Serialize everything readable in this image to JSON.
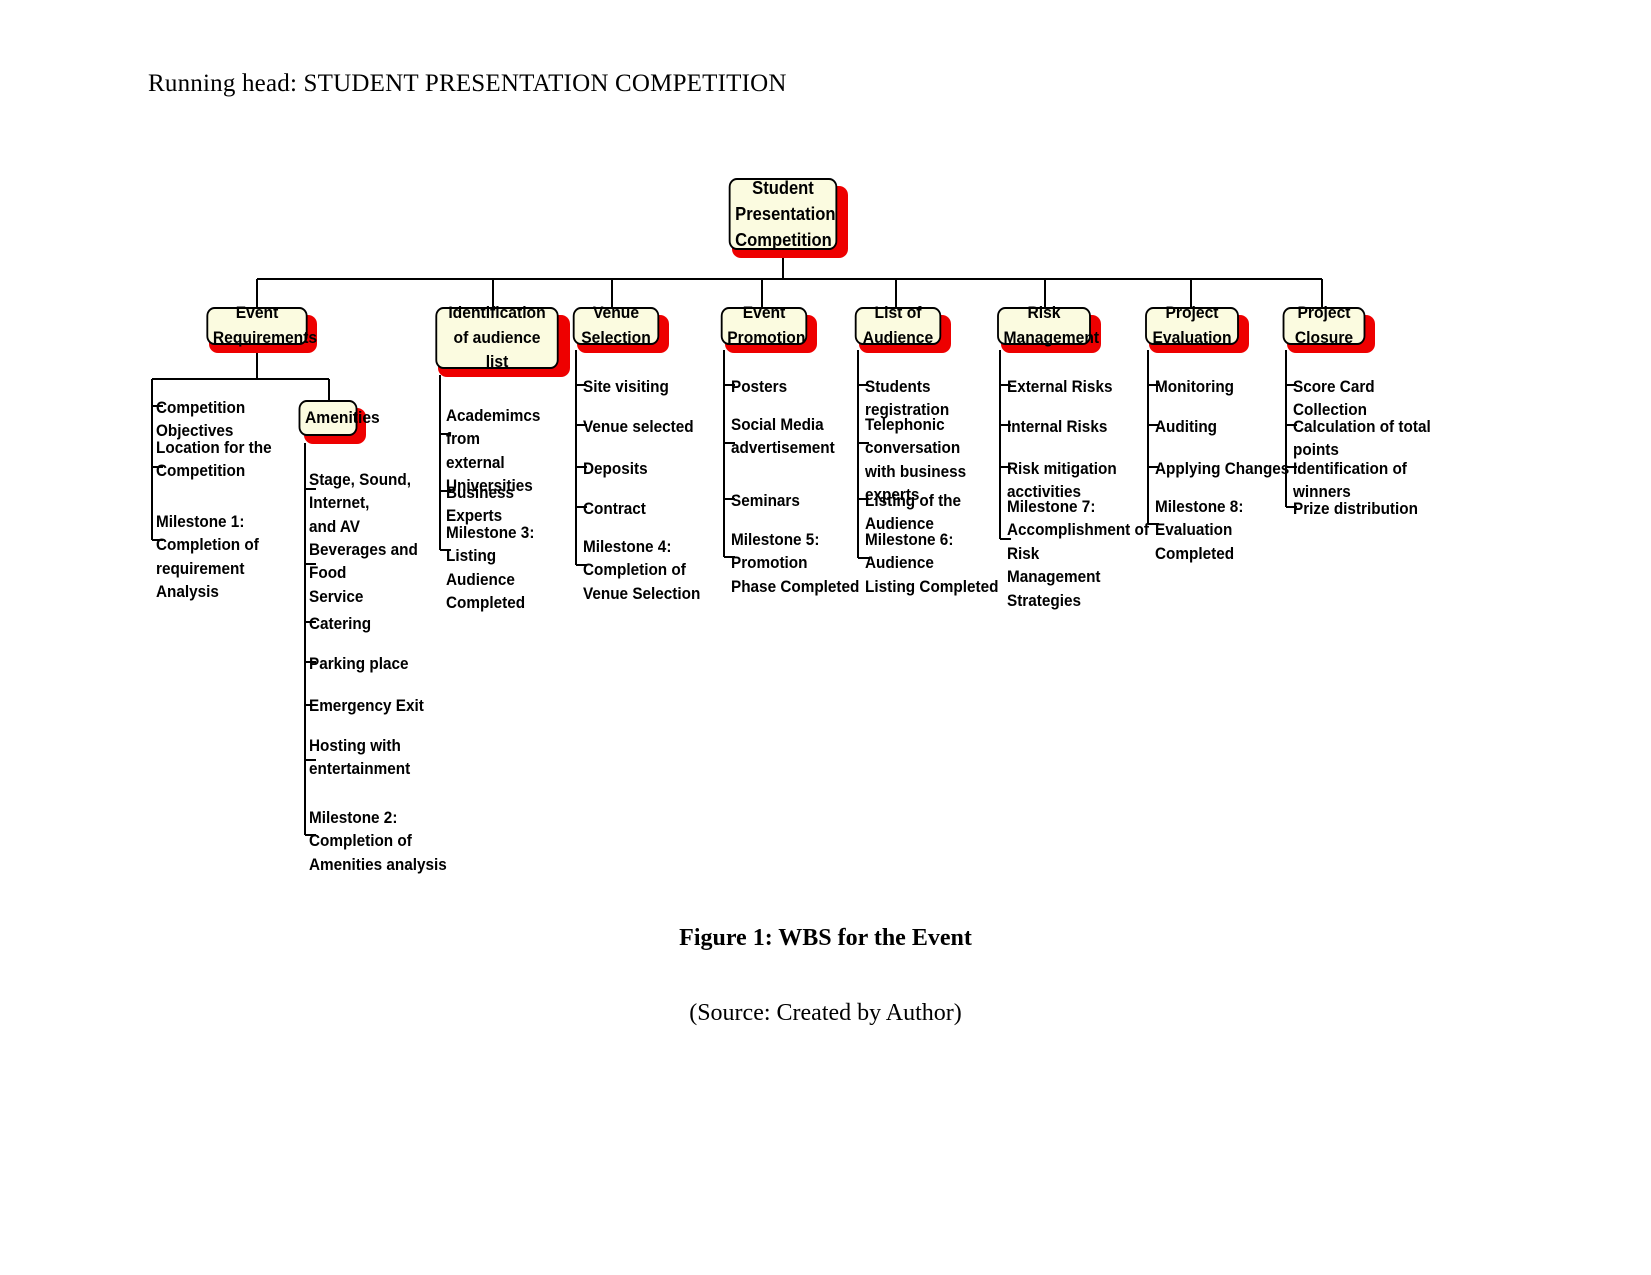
{
  "page": {
    "running_head": "Running head: STUDENT PRESENTATION COMPETITION",
    "figure_caption": "Figure 1: WBS for the Event",
    "figure_source": "(Source: Created by Author)"
  },
  "colors": {
    "node_fill": "#fbfbe0",
    "node_border": "#000000",
    "node_shadow": "#ee0000",
    "connector": "#000000",
    "text": "#000000"
  },
  "chart_data": {
    "type": "diagram",
    "title": "WBS for the Event",
    "root": "Student Presentation Competition",
    "branches": [
      {
        "label": "Event Requirements",
        "items": [
          "Competition Objectives",
          "Location for the\nCompetition",
          "Milestone 1: Completion of\nrequirement Analysis"
        ],
        "subnode": {
          "label": "Amenities",
          "items": [
            "Stage, Sound, Internet,\nand AV",
            "Beverages and Food\nService",
            "Catering",
            "Parking place",
            "Emergency Exit",
            "Hosting with\nentertainment",
            "Milestone 2: Completion of\nAmenities analysis"
          ]
        }
      },
      {
        "label": "Identification of audience\nlist",
        "items": [
          "Academimcs from\nexternal Universities",
          "Business Experts",
          "Milestone 3: Listing\nAudience Completed"
        ]
      },
      {
        "label": "Venue Selection",
        "items": [
          "Site visiting",
          "Venue selected",
          "Deposits",
          "Contract",
          "Milestone 4: Completion of\nVenue Selection"
        ]
      },
      {
        "label": "Event Promotion",
        "items": [
          "Posters",
          "Social Media\nadvertisement",
          "Seminars",
          "Milestone 5: Promotion\nPhase Completed"
        ]
      },
      {
        "label": "List of Audience",
        "items": [
          "Students registration",
          "Telephonic conversation\nwith business experts",
          "Listing of the Audience",
          "Milestone 6: Audience\nListing Completed"
        ]
      },
      {
        "label": "Risk Management",
        "items": [
          "External Risks",
          "Internal Risks",
          "Risk mitigation acctivities",
          "Milestone 7:\nAccomplishment of Risk\nManagement Strategies"
        ]
      },
      {
        "label": "Project Evaluation",
        "items": [
          "Monitoring",
          "Auditing",
          "Applying Changes",
          "Milestone 8: Evaluation\nCompleted"
        ]
      },
      {
        "label": "Project Closure",
        "items": [
          "Score Card Collection",
          "Calculation of total points",
          "Identification of winners",
          "Prize distribution"
        ]
      }
    ]
  }
}
